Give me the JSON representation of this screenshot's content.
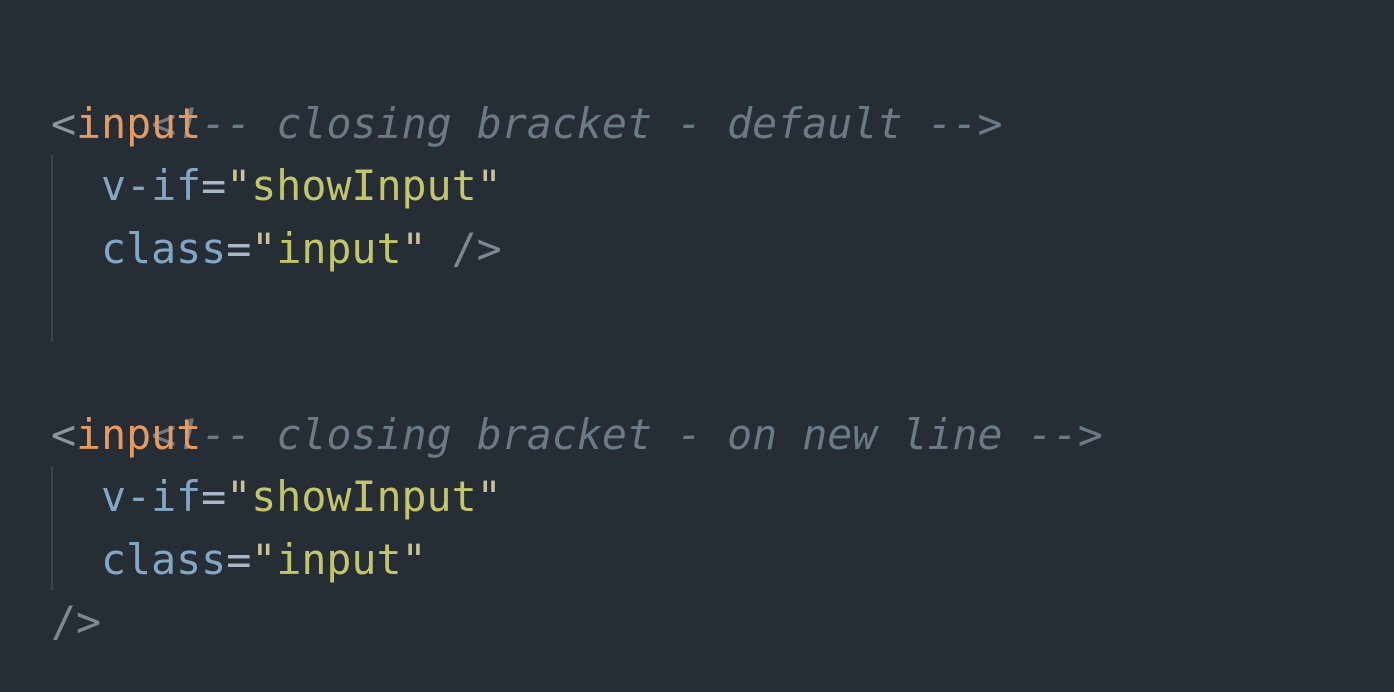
{
  "code": {
    "block1": {
      "comment": "<!-- closing bracket - default -->",
      "tag_open": "<",
      "tag_name": "input",
      "attr1_name": "v-if",
      "attr1_eq": "=",
      "attr1_q1": "\"",
      "attr1_value": "showInput",
      "attr1_q2": "\"",
      "attr2_name": "class",
      "attr2_eq": "=",
      "attr2_q1": "\"",
      "attr2_value": "input",
      "attr2_q2": "\"",
      "close": " />"
    },
    "block2": {
      "comment": "<!-- closing bracket - on new line -->",
      "tag_open": "<",
      "tag_name": "input",
      "attr1_name": "v-if",
      "attr1_eq": "=",
      "attr1_q1": "\"",
      "attr1_value": "showInput",
      "attr1_q2": "\"",
      "attr2_name": "class",
      "attr2_eq": "=",
      "attr2_q1": "\"",
      "attr2_value": "input",
      "attr2_q2": "\"",
      "close": "/>"
    }
  },
  "colors": {
    "background": "#262d35",
    "comment": "#6c7a85",
    "tag": "#e49a63",
    "attribute": "#82a6c6",
    "string": "#c3c56b"
  }
}
